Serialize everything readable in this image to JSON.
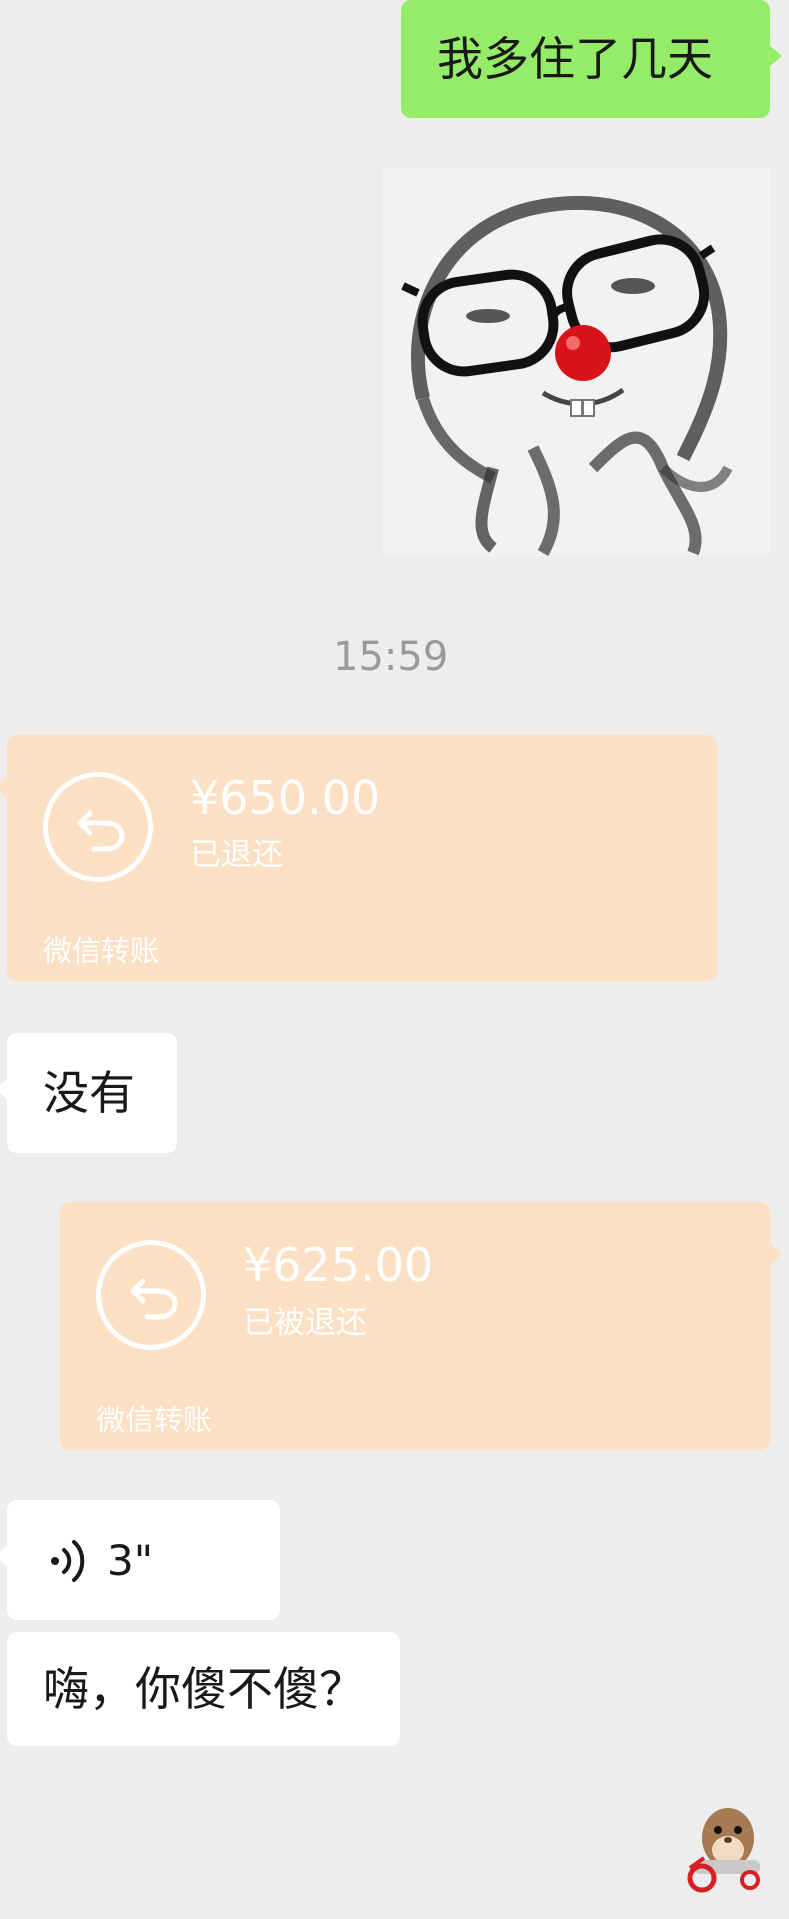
{
  "messages": {
    "msg1": {
      "text": "我多住了几天"
    },
    "timestamp": "15:59",
    "transfer1": {
      "amount": "¥650.00",
      "status": "已退还",
      "brand": "微信转账"
    },
    "msg2": {
      "text": "没有"
    },
    "transfer2": {
      "amount": "¥625.00",
      "status": "已被退还",
      "brand": "微信转账"
    },
    "voice": {
      "duration": "3\""
    },
    "msg3": {
      "text": "嗨，你傻不傻？"
    }
  },
  "colors": {
    "background": "#ededed",
    "outgoing_bubble": "#95ec69",
    "incoming_bubble": "#ffffff",
    "transfer_card": "#fce0c4",
    "timestamp": "#9a9a9a"
  },
  "icons": {
    "transfer1": "return-arrow-icon",
    "transfer2": "return-arrow-icon",
    "voice": "voice-wave-icon"
  }
}
